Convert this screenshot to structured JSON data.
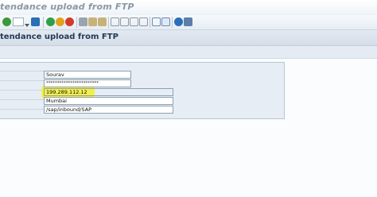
{
  "window": {
    "title_fragment": "tendance upload from FTP"
  },
  "toolbar": {
    "icons": [
      "enter-icon",
      "command-field",
      "save-icon",
      "back-icon",
      "exit-icon",
      "cancel-icon",
      "print-icon",
      "find-icon",
      "find-next-icon",
      "first-page-icon",
      "previous-page-icon",
      "next-page-icon",
      "last-page-icon",
      "new-session-icon",
      "shortcut-icon",
      "help-icon",
      "customize-icon"
    ]
  },
  "screen": {
    "title": "tendance upload from FTP"
  },
  "form": {
    "user": "Sourav",
    "password": "************************",
    "host": "199.289.112.12",
    "location": "Mumbai",
    "path": "/sap/inbound/SAP"
  },
  "colors": {
    "highlight": "#f5f03a",
    "title_text": "#243a57",
    "frame_bg": "#e6edf5"
  }
}
